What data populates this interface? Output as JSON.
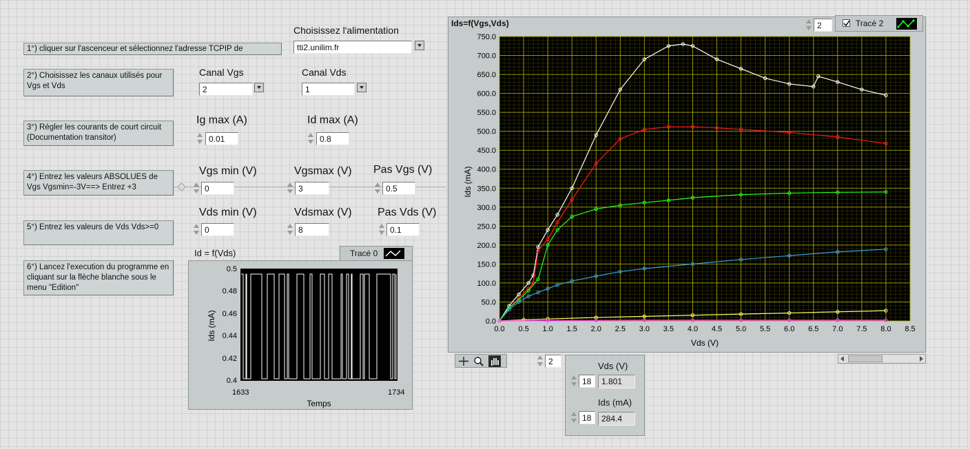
{
  "steps": [
    {
      "text": "1°) cliquer sur l'ascenceur et sélectionnez l'adresse TCPIP de"
    },
    {
      "text": "2°) Choisissez les canaux utilisés pour Vgs et Vds"
    },
    {
      "text": "3°) Régler les courants de court circuit (Documentation transitor)"
    },
    {
      "text": "4°) Entrez les valeurs ABSOLUES de Vgs Vgsmin=-3V==> Entrez +3"
    },
    {
      "text": "5°) Entrez les valeurs de Vds Vds>=0"
    },
    {
      "text": "6°) Lancez l'execution du programme en cliquant sur la flèche blanche sous le menu \"Edition\""
    }
  ],
  "alimentation": {
    "label": "Choisissez l'alimentation",
    "value": "tti2.unilim.fr"
  },
  "canal_vgs": {
    "label": "Canal Vgs",
    "value": "2"
  },
  "canal_vds": {
    "label": "Canal Vds",
    "value": "1"
  },
  "ig_max": {
    "label": "Ig max (A)",
    "value": "0.01"
  },
  "id_max": {
    "label": "Id max (A)",
    "value": "0.8"
  },
  "vgs_min": {
    "label": "Vgs min (V)",
    "value": "0"
  },
  "vgs_max": {
    "label": "Vgsmax (V)",
    "value": "3"
  },
  "pas_vgs": {
    "label": "Pas Vgs (V)",
    "value": "0.5"
  },
  "vds_min": {
    "label": "Vds min (V)",
    "value": "0"
  },
  "vds_max": {
    "label": "Vdsmax (V)",
    "value": "8"
  },
  "pas_vds": {
    "label": "Pas Vds (V)",
    "value": "0.1"
  },
  "small_chart": {
    "title": "Id = f(Vds)",
    "legend": "Tracé 0",
    "xlabel": "Temps",
    "ylabel": "Ids (mA)",
    "xticks": [
      "1633",
      "1734"
    ],
    "yticks": [
      "0.5",
      "0.48",
      "0.46",
      "0.44",
      "0.42",
      "0.4"
    ],
    "colors": {
      "bg": "#000000",
      "trace": "#ffffff"
    }
  },
  "main_chart": {
    "title": "Ids=f(Vgs,Vds)",
    "plot_index": "2",
    "legend_label": "Tracé 2",
    "legend_checked": true,
    "cursor_index": "2"
  },
  "cursor_panel": {
    "vds_label": "Vds (V)",
    "vds_index": "18",
    "vds_value": "1.801",
    "ids_label": "Ids (mA)",
    "ids_index": "18",
    "ids_value": "284.4"
  },
  "chart_data": {
    "type": "line",
    "title": "Ids=f(Vgs,Vds)",
    "xlabel": "Vds (V)",
    "ylabel": "Ids (mA)",
    "xlim": [
      0,
      8.5
    ],
    "ylim": [
      0,
      750
    ],
    "xticks": [
      "0.0",
      "0.5",
      "1.0",
      "1.5",
      "2.0",
      "2.5",
      "3.0",
      "3.5",
      "4.0",
      "4.5",
      "5.0",
      "5.5",
      "6.0",
      "6.5",
      "7.0",
      "7.5",
      "8.0",
      "8.5"
    ],
    "yticks": [
      "0.0",
      "50.0",
      "100.0",
      "150.0",
      "200.0",
      "250.0",
      "300.0",
      "350.0",
      "400.0",
      "450.0",
      "500.0",
      "550.0",
      "600.0",
      "650.0",
      "700.0",
      "750.0"
    ],
    "grid": true,
    "background": "#000000",
    "grid_color": "#a8a800",
    "series": [
      {
        "color": "#ffffff",
        "x": [
          0,
          0.2,
          0.4,
          0.6,
          0.7,
          0.8,
          1.0,
          1.2,
          1.5,
          2.0,
          2.5,
          3.0,
          3.5,
          3.8,
          4.0,
          4.5,
          5.0,
          5.5,
          6.0,
          6.5,
          6.6,
          7.0,
          7.5,
          8.0
        ],
        "y": [
          0,
          40,
          70,
          100,
          120,
          195,
          240,
          280,
          350,
          490,
          610,
          690,
          725,
          730,
          725,
          690,
          665,
          640,
          625,
          618,
          645,
          630,
          610,
          595
        ]
      },
      {
        "color": "#ff1a1a",
        "x": [
          0,
          0.2,
          0.4,
          0.6,
          0.7,
          0.8,
          1.0,
          1.2,
          1.5,
          2.0,
          2.5,
          3.0,
          3.5,
          4.0,
          4.5,
          5.0,
          6.0,
          7.0,
          8.0
        ],
        "y": [
          0,
          35,
          60,
          85,
          100,
          185,
          215,
          260,
          320,
          415,
          480,
          505,
          512,
          512,
          509,
          505,
          497,
          485,
          468
        ]
      },
      {
        "color": "#22ff22",
        "x": [
          0,
          0.2,
          0.4,
          0.6,
          0.8,
          1.0,
          1.2,
          1.5,
          2.0,
          2.5,
          3.0,
          3.5,
          4.0,
          5.0,
          6.0,
          7.0,
          8.0
        ],
        "y": [
          0,
          35,
          55,
          80,
          110,
          200,
          240,
          275,
          295,
          305,
          312,
          318,
          325,
          333,
          337,
          339,
          340
        ]
      },
      {
        "color": "#3aa0d8",
        "x": [
          0,
          0.2,
          0.4,
          0.6,
          0.8,
          1.0,
          1.2,
          1.5,
          2.0,
          2.5,
          3.0,
          4.0,
          5.0,
          6.0,
          7.0,
          8.0
        ],
        "y": [
          0,
          30,
          50,
          65,
          75,
          85,
          95,
          105,
          118,
          130,
          138,
          150,
          162,
          172,
          182,
          189
        ]
      },
      {
        "color": "#ffff66",
        "x": [
          0,
          0.5,
          1.0,
          2.0,
          3.0,
          4.0,
          5.0,
          6.0,
          7.0,
          8.0
        ],
        "y": [
          0,
          3,
          5,
          9,
          12,
          15,
          18,
          21,
          24,
          27
        ]
      },
      {
        "color": "#ff33ff",
        "x": [
          0,
          1.0,
          2.0,
          3.0,
          4.0,
          5.0,
          6.0,
          7.0,
          8.0
        ],
        "y": [
          0,
          1,
          1.5,
          2,
          2,
          2,
          2,
          2,
          2
        ]
      }
    ]
  }
}
